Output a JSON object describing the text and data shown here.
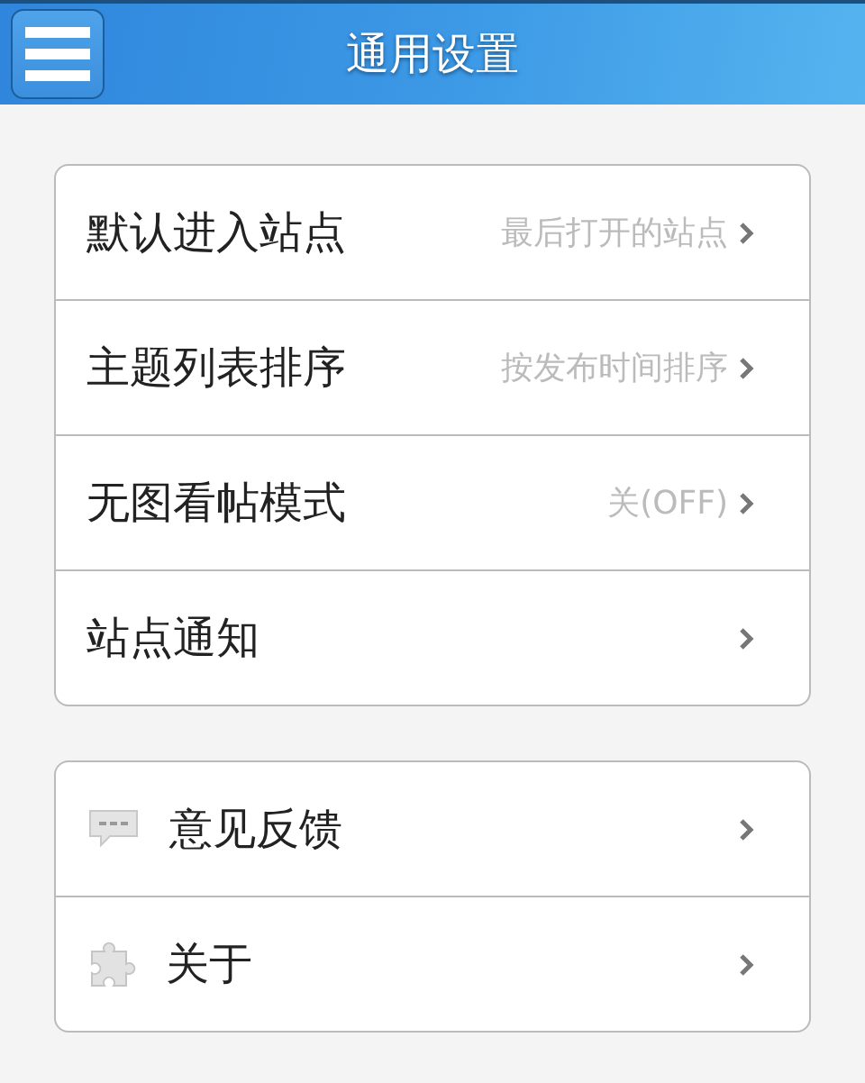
{
  "header": {
    "title": "通用设置"
  },
  "groups": [
    {
      "items": [
        {
          "label": "默认进入站点",
          "value": "最后打开的站点"
        },
        {
          "label": "主题列表排序",
          "value": "按发布时间排序"
        },
        {
          "label": "无图看帖模式",
          "value": "关(OFF)"
        },
        {
          "label": "站点通知"
        }
      ]
    },
    {
      "items": [
        {
          "label": "意见反馈",
          "kind": "chat"
        },
        {
          "label": "关于",
          "kind": "puzzle"
        }
      ]
    }
  ]
}
